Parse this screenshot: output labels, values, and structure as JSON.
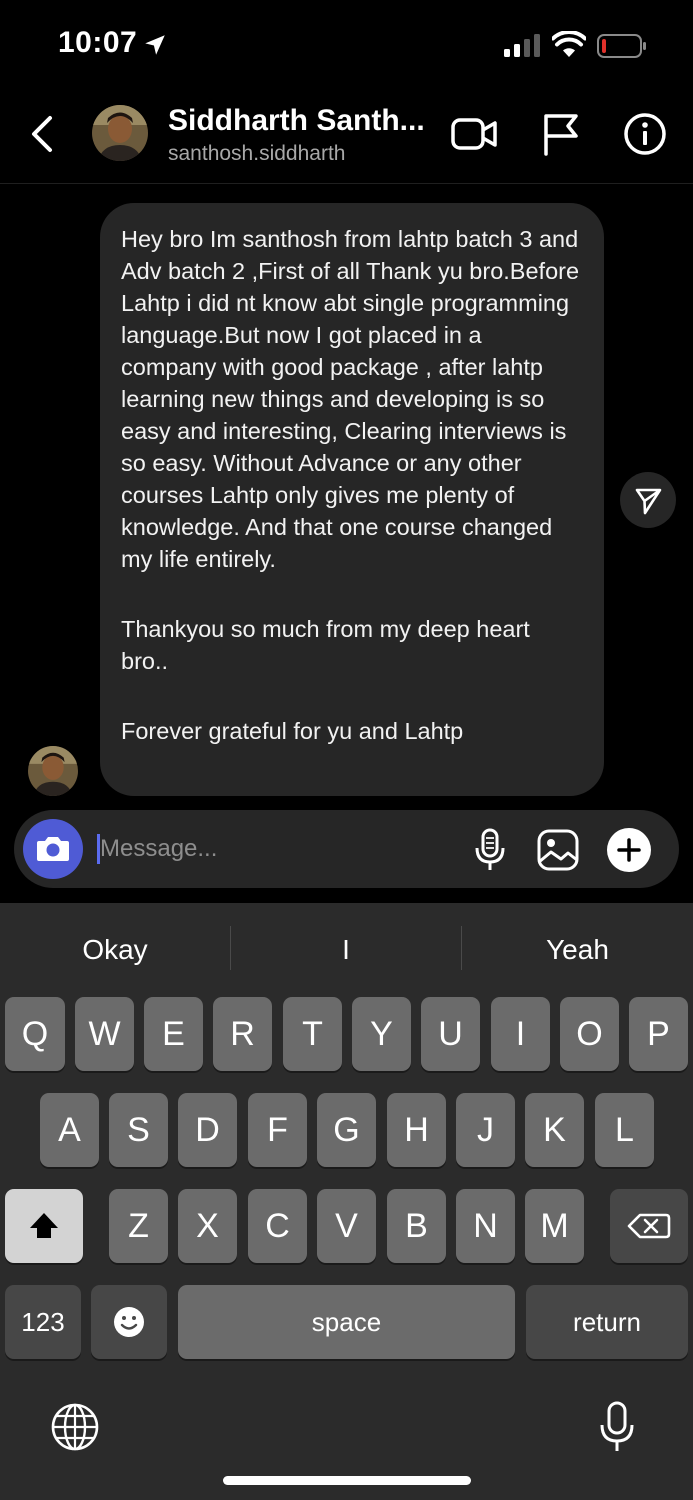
{
  "status_bar": {
    "time": "10:07"
  },
  "header": {
    "name": "Siddharth Santh...",
    "username": "santhosh.siddharth"
  },
  "message": {
    "paragraphs": [
      "Hey bro Im santhosh from lahtp batch 3 and Adv batch 2 ,First of all Thank yu bro.Before Lahtp i did nt know abt single programming language.But now I got placed in a company with good package , after lahtp learning new things and developing is so easy and interesting, Clearing interviews is so easy. Without Advance or any other courses Lahtp only gives me plenty of knowledge. And that one course changed my life entirely.",
      "Thankyou so much from my deep heart bro..",
      "Forever grateful for yu and Lahtp"
    ]
  },
  "composer": {
    "placeholder": "Message..."
  },
  "keyboard": {
    "suggestions": [
      "Okay",
      "I",
      "Yeah"
    ],
    "row1": [
      "Q",
      "W",
      "E",
      "R",
      "T",
      "Y",
      "U",
      "I",
      "O",
      "P"
    ],
    "row2": [
      "A",
      "S",
      "D",
      "F",
      "G",
      "H",
      "J",
      "K",
      "L"
    ],
    "row3": [
      "Z",
      "X",
      "C",
      "V",
      "B",
      "N",
      "M"
    ],
    "numbers_label": "123",
    "space_label": "space",
    "return_label": "return"
  },
  "icons": {
    "status": [
      "location-arrow-icon",
      "signal-icon",
      "wifi-icon",
      "battery-icon"
    ],
    "header": [
      "back-chevron-icon",
      "video-call-icon",
      "flag-icon",
      "info-icon"
    ],
    "composer": [
      "camera-icon",
      "microphone-icon",
      "gallery-icon",
      "plus-icon"
    ],
    "keyboard": [
      "shift-icon",
      "delete-icon",
      "emoji-icon",
      "globe-icon",
      "dictation-mic-icon"
    ]
  },
  "colors": {
    "background": "#000000",
    "bubble": "#262626",
    "camera_button": "#4f5bd5",
    "battery_low": "#e0312b",
    "keyboard": "#2b2b2b"
  }
}
